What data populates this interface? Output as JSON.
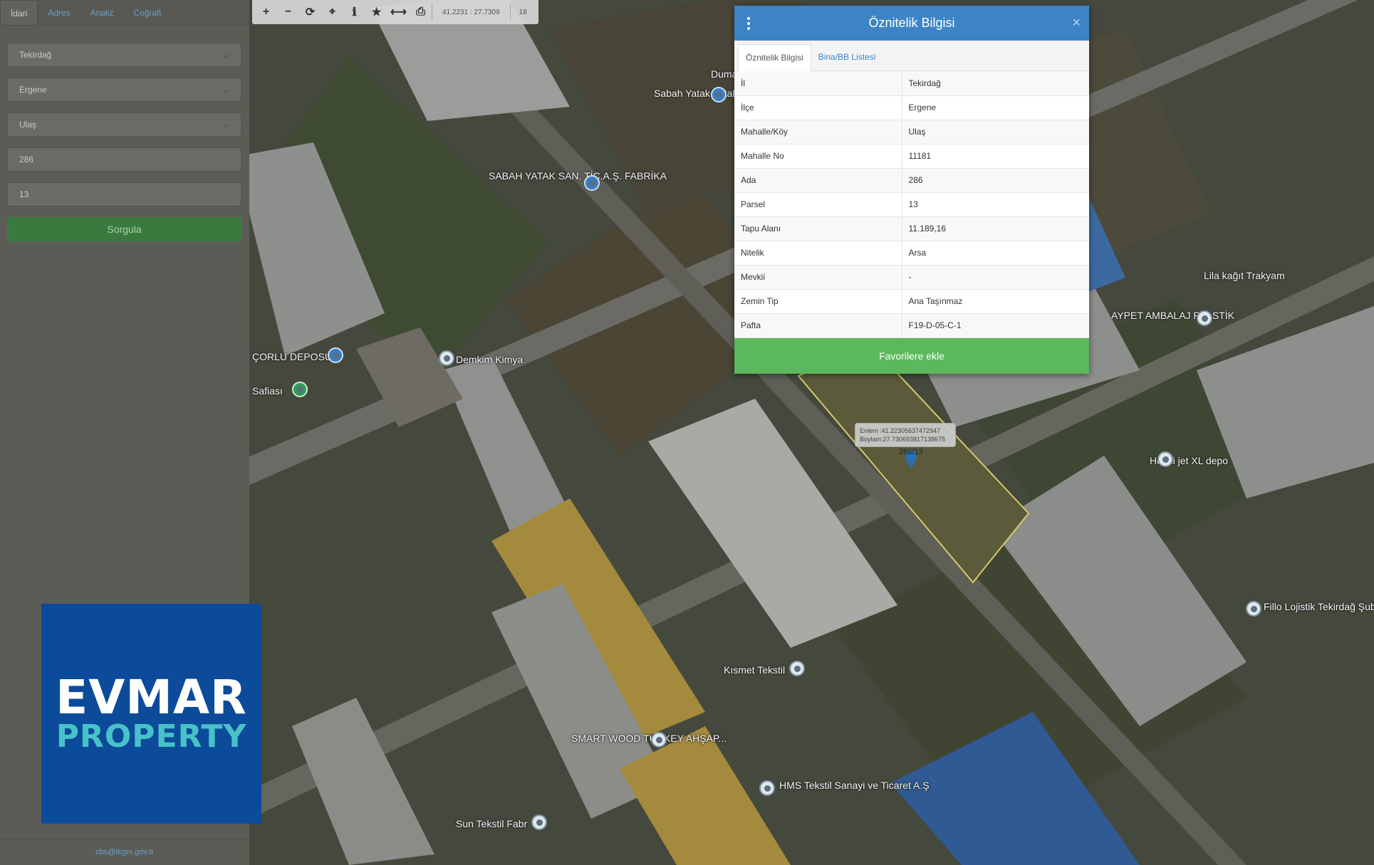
{
  "sidebar": {
    "tabs": [
      "İdari",
      "Adres",
      "Analiz",
      "Coğrafi"
    ],
    "fields": {
      "il": "Tekirdağ",
      "ilce": "Ergene",
      "mahalle": "Ulaş",
      "ada": "286",
      "parsel": "13"
    },
    "query_button": "Sorgula",
    "footer_email": "cbs@tkgm.gov.tr"
  },
  "toolbar": {
    "zoom_in": "+",
    "zoom_out": "−",
    "refresh": "⟳",
    "locate": "⌖",
    "info": "ℹ",
    "star": "★",
    "measure": "⟷",
    "print": "⎙",
    "coords": "41.2231 : 27.7309",
    "zoom": "18"
  },
  "popup": {
    "title": "Öznitelik Bilgisi",
    "close": "×",
    "tabs": [
      "Öznitelik Bilgisi",
      "Bina/BB Listesi"
    ],
    "rows": [
      {
        "key": "İl",
        "value": "Tekirdağ"
      },
      {
        "key": "İlçe",
        "value": "Ergene"
      },
      {
        "key": "Mahalle/Köy",
        "value": "Ulaş"
      },
      {
        "key": "Mahalle No",
        "value": "11181"
      },
      {
        "key": "Ada",
        "value": "286"
      },
      {
        "key": "Parsel",
        "value": "13"
      },
      {
        "key": "Tapu Alanı",
        "value": "11.189,16"
      },
      {
        "key": "Nitelik",
        "value": "Arsa"
      },
      {
        "key": "Mevkii",
        "value": "-"
      },
      {
        "key": "Zemin Tip",
        "value": "Ana Taşınmaz"
      },
      {
        "key": "Pafta",
        "value": "F19-D-05-C-1"
      }
    ],
    "favorite_button": "Favorilere ekle"
  },
  "map": {
    "tooltip": {
      "lat": "Enlem :41.22305637472947",
      "lon": "Boylam:27.730693817138675"
    },
    "parcel_label": "286/13",
    "labels": [
      "Duma",
      "Sabah Yatak Yatak Mağazası",
      "SABAH YATAK SAN. TİC.A.Ş. FABRİKA",
      "ÇORLU DEPOSU",
      "Safiası",
      "Demkim Kimya",
      "Lila kağıt Trakyam",
      "AYPET AMBALAJ PLASTİK",
      "Hepsi jet XL depo",
      "Fillo Lojistik Tekirdağ Şubesi",
      "Kısmet Tekstil",
      "SMART WOOD TURKEY AHŞAP...",
      "HMS Tekstil Sanayi ve Ticaret A.Ş",
      "Sun Tekstil Fabr"
    ]
  },
  "logo": {
    "line1": "EVMAR",
    "line2": "PROPERTY"
  }
}
